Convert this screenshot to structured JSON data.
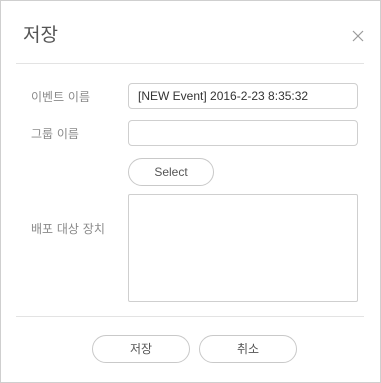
{
  "dialog": {
    "title": "저장",
    "close_icon": "close-icon"
  },
  "form": {
    "event_name": {
      "label": "이벤트 이름",
      "value": "[NEW Event] 2016-2-23 8:35:32"
    },
    "group_name": {
      "label": "그룹 이름",
      "value": ""
    },
    "select_button_label": "Select",
    "target_devices": {
      "label": "배포 대상 장치"
    }
  },
  "footer": {
    "save_label": "저장",
    "cancel_label": "취소"
  }
}
